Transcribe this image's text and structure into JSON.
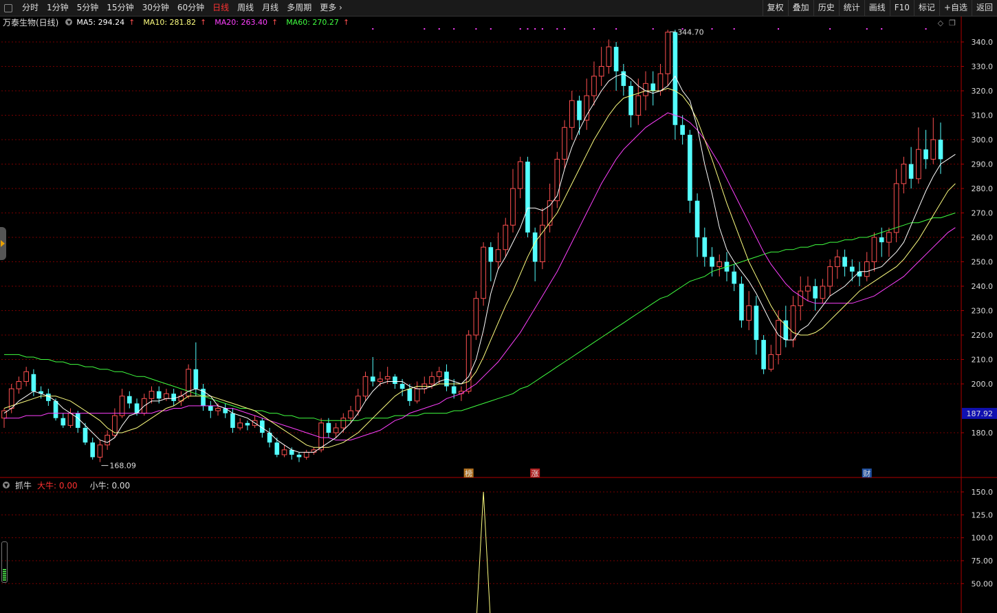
{
  "toolbar": {
    "tabs": [
      "分时",
      "1分钟",
      "5分钟",
      "15分钟",
      "30分钟",
      "60分钟",
      "日线",
      "周线",
      "月线",
      "多周期",
      "更多"
    ],
    "active_tab": "日线",
    "right_buttons": [
      "复权",
      "叠加",
      "历史",
      "统计",
      "画线",
      "F10",
      "标记",
      "+自选",
      "返回"
    ]
  },
  "stock": {
    "title": "万泰生物(日线)",
    "ma5": "MA5: 294.24",
    "ma10": "MA10: 281.82",
    "ma20": "MA20: 263.40",
    "ma60": "MA60: 270.27"
  },
  "indicator": {
    "name": "抓牛",
    "big": "大牛: 0.00",
    "small": "小牛: 0.00"
  },
  "colors": {
    "up": "#ff5050",
    "down": "#54ffff",
    "ma5": "#ffffff",
    "ma10": "#ffff80",
    "ma20": "#ff40ff",
    "ma60": "#40ff40",
    "grid": "#7a0000",
    "axis": "#b00000",
    "price_tag": "#1010b0"
  },
  "price_axis": {
    "ticks": [
      "340.0",
      "330.0",
      "320.0",
      "310.0",
      "300.0",
      "290.0",
      "280.0",
      "270.0",
      "260.0",
      "250.0",
      "240.0",
      "230.0",
      "220.0",
      "210.0",
      "200.0",
      "180.0"
    ],
    "current_price": "187.92"
  },
  "indicator_axis": {
    "ticks": [
      "150.0",
      "125.0",
      "100.0",
      "75.00",
      "50.00"
    ]
  },
  "annotations": {
    "high_label": "344.70",
    "low_label": "168.09",
    "markers": [
      "榜",
      "涨",
      "财"
    ]
  },
  "chart_data": {
    "type": "candlestick",
    "y_range": [
      160,
      350
    ],
    "candles": [
      [
        186,
        189,
        182,
        190
      ],
      [
        190,
        198,
        188,
        200
      ],
      [
        198,
        201,
        196,
        203
      ],
      [
        201,
        205,
        199,
        207
      ],
      [
        204,
        197,
        195,
        206
      ],
      [
        197,
        196,
        194,
        199
      ],
      [
        196,
        193,
        191,
        198
      ],
      [
        193,
        186,
        185,
        194
      ],
      [
        186,
        183,
        182,
        188
      ],
      [
        183,
        188,
        182,
        190
      ],
      [
        188,
        182,
        180,
        189
      ],
      [
        182,
        176,
        175,
        184
      ],
      [
        176,
        170,
        169,
        178
      ],
      [
        170,
        175,
        168,
        177
      ],
      [
        175,
        179,
        173,
        181
      ],
      [
        179,
        187,
        178,
        190
      ],
      [
        187,
        195,
        186,
        198
      ],
      [
        195,
        192,
        190,
        197
      ],
      [
        192,
        188,
        187,
        194
      ],
      [
        188,
        194,
        187,
        196
      ],
      [
        194,
        197,
        192,
        199
      ],
      [
        197,
        194,
        192,
        199
      ],
      [
        194,
        196,
        193,
        198
      ],
      [
        196,
        193,
        191,
        198
      ],
      [
        193,
        195,
        191,
        197
      ],
      [
        195,
        206,
        194,
        208
      ],
      [
        206,
        198,
        195,
        217
      ],
      [
        198,
        191,
        189,
        200
      ],
      [
        191,
        189,
        186,
        193
      ],
      [
        189,
        190,
        187,
        192
      ],
      [
        190,
        188,
        186,
        192
      ],
      [
        188,
        182,
        180,
        190
      ],
      [
        182,
        184,
        181,
        186
      ],
      [
        184,
        183,
        181,
        185
      ],
      [
        183,
        185,
        182,
        187
      ],
      [
        185,
        180,
        178,
        186
      ],
      [
        180,
        176,
        174,
        182
      ],
      [
        176,
        171,
        170,
        178
      ],
      [
        171,
        173,
        170,
        175
      ],
      [
        173,
        171,
        169,
        174
      ],
      [
        171,
        170,
        168,
        172
      ],
      [
        170,
        172,
        169,
        173
      ],
      [
        172,
        173,
        171,
        174
      ],
      [
        173,
        184,
        172,
        186
      ],
      [
        184,
        180,
        178,
        186
      ],
      [
        180,
        182,
        178,
        184
      ],
      [
        182,
        186,
        180,
        188
      ],
      [
        186,
        189,
        184,
        191
      ],
      [
        189,
        195,
        187,
        198
      ],
      [
        195,
        203,
        193,
        205
      ],
      [
        203,
        201,
        199,
        211
      ],
      [
        201,
        202,
        199,
        205
      ],
      [
        202,
        203,
        200,
        207
      ],
      [
        203,
        200,
        198,
        204
      ],
      [
        200,
        198,
        195,
        202
      ],
      [
        198,
        193,
        191,
        200
      ],
      [
        193,
        198,
        192,
        201
      ],
      [
        198,
        200,
        196,
        203
      ],
      [
        200,
        203,
        198,
        205
      ],
      [
        203,
        205,
        200,
        207
      ],
      [
        205,
        199,
        197,
        208
      ],
      [
        199,
        196,
        194,
        202
      ],
      [
        196,
        197,
        193,
        199
      ],
      [
        197,
        220,
        196,
        222
      ],
      [
        220,
        235,
        218,
        238
      ],
      [
        235,
        256,
        232,
        258
      ],
      [
        256,
        250,
        242,
        258
      ],
      [
        250,
        255,
        247,
        262
      ],
      [
        255,
        265,
        252,
        268
      ],
      [
        265,
        280,
        262,
        288
      ],
      [
        280,
        291,
        276,
        293
      ],
      [
        291,
        262,
        260,
        293
      ],
      [
        262,
        250,
        242,
        264
      ],
      [
        250,
        265,
        247,
        272
      ],
      [
        265,
        275,
        262,
        282
      ],
      [
        275,
        292,
        272,
        295
      ],
      [
        292,
        305,
        288,
        308
      ],
      [
        305,
        316,
        300,
        320
      ],
      [
        316,
        308,
        302,
        318
      ],
      [
        308,
        318,
        304,
        325
      ],
      [
        318,
        326,
        314,
        332
      ],
      [
        326,
        330,
        322,
        338
      ],
      [
        330,
        338,
        327,
        341
      ],
      [
        338,
        328,
        320,
        340
      ],
      [
        328,
        322,
        318,
        331
      ],
      [
        322,
        310,
        305,
        324
      ],
      [
        310,
        318,
        306,
        325
      ],
      [
        318,
        323,
        312,
        328
      ],
      [
        323,
        320,
        314,
        328
      ],
      [
        320,
        327,
        318,
        331
      ],
      [
        327,
        344,
        322,
        345
      ],
      [
        344,
        306,
        300,
        345
      ],
      [
        306,
        302,
        298,
        310
      ],
      [
        302,
        275,
        270,
        304
      ],
      [
        275,
        260,
        252,
        278
      ],
      [
        260,
        252,
        248,
        264
      ],
      [
        252,
        248,
        244,
        256
      ],
      [
        248,
        250,
        244,
        253
      ],
      [
        250,
        246,
        242,
        254
      ],
      [
        246,
        241,
        238,
        249
      ],
      [
        241,
        226,
        223,
        244
      ],
      [
        226,
        232,
        222,
        238
      ],
      [
        232,
        218,
        212,
        236
      ],
      [
        218,
        206,
        204,
        220
      ],
      [
        206,
        212,
        205,
        216
      ],
      [
        212,
        226,
        208,
        230
      ],
      [
        226,
        218,
        215,
        232
      ],
      [
        218,
        232,
        215,
        236
      ],
      [
        232,
        238,
        226,
        244
      ],
      [
        238,
        240,
        234,
        244
      ],
      [
        240,
        235,
        230,
        243
      ],
      [
        235,
        240,
        233,
        243
      ],
      [
        240,
        248,
        236,
        251
      ],
      [
        248,
        252,
        243,
        255
      ],
      [
        252,
        248,
        244,
        255
      ],
      [
        248,
        246,
        242,
        251
      ],
      [
        246,
        244,
        240,
        250
      ],
      [
        244,
        250,
        242,
        254
      ],
      [
        250,
        260,
        246,
        262
      ],
      [
        260,
        258,
        252,
        264
      ],
      [
        258,
        262,
        252,
        264
      ],
      [
        262,
        282,
        258,
        288
      ],
      [
        282,
        290,
        278,
        293
      ],
      [
        290,
        284,
        280,
        297
      ],
      [
        284,
        296,
        282,
        305
      ],
      [
        296,
        292,
        288,
        304
      ],
      [
        292,
        300,
        290,
        309
      ],
      [
        300,
        292,
        286,
        307
      ]
    ],
    "ma5": [
      188,
      190,
      193,
      195,
      197,
      196,
      195,
      193,
      190,
      188,
      186,
      183,
      180,
      177,
      176,
      178,
      183,
      187,
      188,
      191,
      193,
      193,
      194,
      194,
      195,
      197,
      198,
      197,
      195,
      191,
      190,
      188,
      187,
      186,
      184,
      182,
      180,
      177,
      175,
      173,
      172,
      172,
      172,
      174,
      176,
      178,
      181,
      184,
      188,
      193,
      197,
      200,
      201,
      201,
      201,
      199,
      198,
      198,
      199,
      201,
      202,
      201,
      200,
      203,
      210,
      222,
      237,
      247,
      252,
      258,
      264,
      272,
      272,
      271,
      273,
      277,
      288,
      297,
      304,
      310,
      315,
      320,
      324,
      326,
      327,
      325,
      322,
      320,
      319,
      320,
      322,
      326,
      320,
      316,
      305,
      290,
      278,
      264,
      255,
      250,
      246,
      242,
      237,
      231,
      225,
      220,
      218,
      218,
      222,
      224,
      228,
      232,
      236,
      238,
      240,
      243,
      246,
      246,
      247,
      248,
      251,
      254,
      258,
      265,
      272,
      279,
      285,
      290,
      292,
      294
    ],
    "ma10": [
      190,
      191,
      192,
      193,
      194,
      195,
      195,
      195,
      194,
      193,
      191,
      189,
      187,
      185,
      182,
      180,
      180,
      181,
      182,
      184,
      186,
      188,
      190,
      191,
      193,
      195,
      195,
      195,
      195,
      194,
      193,
      192,
      191,
      190,
      189,
      187,
      185,
      183,
      181,
      179,
      177,
      175,
      174,
      174,
      174,
      175,
      176,
      178,
      180,
      183,
      186,
      189,
      192,
      195,
      197,
      198,
      199,
      199,
      199,
      200,
      200,
      200,
      200,
      201,
      205,
      211,
      218,
      225,
      232,
      238,
      245,
      252,
      258,
      262,
      266,
      270,
      276,
      282,
      288,
      294,
      300,
      305,
      310,
      314,
      317,
      318,
      319,
      320,
      320,
      320,
      321,
      320,
      318,
      314,
      308,
      300,
      292,
      283,
      274,
      266,
      258,
      250,
      244,
      238,
      232,
      227,
      224,
      221,
      220,
      220,
      221,
      223,
      226,
      229,
      232,
      235,
      238,
      240,
      242,
      244,
      246,
      248,
      251,
      255,
      259,
      264,
      269,
      274,
      279,
      282
    ],
    "ma20": [
      186,
      186,
      186,
      187,
      187,
      187,
      188,
      188,
      188,
      188,
      188,
      188,
      188,
      188,
      188,
      188,
      188,
      188,
      188,
      188,
      188,
      189,
      189,
      190,
      190,
      191,
      191,
      191,
      191,
      191,
      190,
      190,
      189,
      188,
      187,
      186,
      185,
      184,
      183,
      182,
      181,
      180,
      179,
      178,
      178,
      177,
      177,
      177,
      178,
      179,
      180,
      181,
      183,
      185,
      186,
      188,
      189,
      190,
      191,
      192,
      194,
      195,
      196,
      198,
      200,
      203,
      206,
      209,
      213,
      217,
      221,
      226,
      231,
      236,
      241,
      246,
      252,
      258,
      264,
      270,
      276,
      282,
      287,
      292,
      296,
      299,
      302,
      305,
      307,
      309,
      311,
      310,
      309,
      307,
      304,
      300,
      295,
      290,
      284,
      278,
      272,
      266,
      260,
      254,
      249,
      245,
      241,
      238,
      236,
      234,
      233,
      233,
      233,
      233,
      233,
      233,
      234,
      235,
      236,
      238,
      240,
      242,
      244,
      247,
      250,
      253,
      256,
      259,
      262,
      264
    ],
    "ma60": [
      212,
      212,
      212,
      211,
      211,
      210,
      210,
      209,
      209,
      208,
      208,
      207,
      207,
      206,
      206,
      205,
      205,
      204,
      203,
      203,
      202,
      201,
      200,
      199,
      198,
      197,
      196,
      195,
      194,
      193,
      192,
      191,
      190,
      190,
      189,
      189,
      188,
      188,
      187,
      187,
      186,
      186,
      186,
      185,
      185,
      185,
      185,
      185,
      185,
      186,
      186,
      186,
      186,
      187,
      187,
      187,
      187,
      188,
      188,
      188,
      188,
      189,
      189,
      190,
      191,
      192,
      193,
      194,
      195,
      196,
      198,
      199,
      201,
      203,
      205,
      207,
      209,
      211,
      213,
      215,
      217,
      219,
      221,
      223,
      225,
      227,
      229,
      231,
      233,
      235,
      236,
      238,
      240,
      242,
      243,
      244,
      246,
      247,
      248,
      249,
      250,
      251,
      252,
      253,
      254,
      254,
      255,
      255,
      256,
      256,
      257,
      257,
      258,
      258,
      259,
      259,
      260,
      260,
      261,
      262,
      263,
      264,
      265,
      266,
      266,
      267,
      268,
      268,
      269,
      270
    ],
    "indicator_range": [
      25,
      160
    ],
    "indicator": {
      "spike_index": 65,
      "spike_value": 150,
      "base_value": 0
    }
  }
}
